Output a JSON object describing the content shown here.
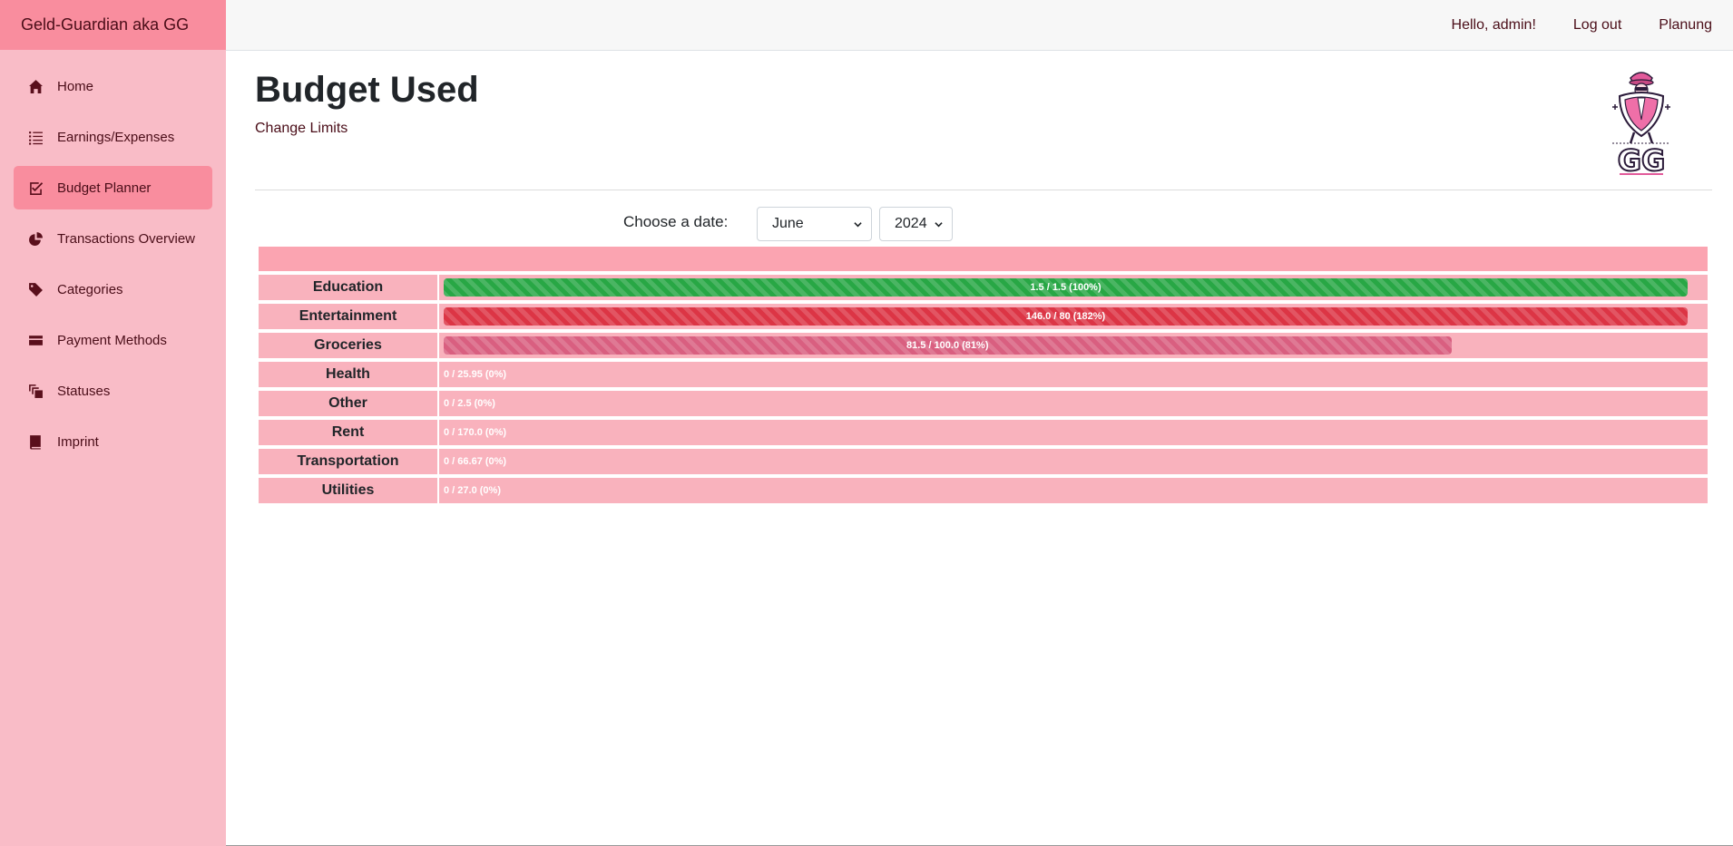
{
  "app": {
    "brand": "Geld-Guardian aka GG"
  },
  "sidebar": {
    "items": [
      {
        "label": "Home",
        "icon": "home-icon",
        "active": false
      },
      {
        "label": "Earnings/Expenses",
        "icon": "list-icon",
        "active": false
      },
      {
        "label": "Budget Planner",
        "icon": "check-square-icon",
        "active": true
      },
      {
        "label": "Transactions Overview",
        "icon": "pie-chart-icon",
        "active": false
      },
      {
        "label": "Categories",
        "icon": "tag-icon",
        "active": false
      },
      {
        "label": "Payment Methods",
        "icon": "credit-card-icon",
        "active": false
      },
      {
        "label": "Statuses",
        "icon": "stack-icon",
        "active": false
      },
      {
        "label": "Imprint",
        "icon": "book-icon",
        "active": false
      }
    ]
  },
  "topbar": {
    "greeting": "Hello, admin!",
    "logout": "Log out",
    "planung": "Planung"
  },
  "main": {
    "title": "Budget Used",
    "change_limits": "Change Limits",
    "date_label": "Choose a date:",
    "month": "June",
    "year": "2024"
  },
  "colors": {
    "brand": "#f98d9e",
    "sidebar": "#f9bcc7",
    "row": "#f9b2bd",
    "success": "#28a745",
    "danger": "#dc3545",
    "warning_pink": "#d95f80"
  },
  "budget_rows": [
    {
      "category": "Education",
      "label": "1.5 / 1.5 (100%)",
      "percent": 100,
      "color": "green"
    },
    {
      "category": "Entertainment",
      "label": "146.0 / 80 (182%)",
      "percent": 182,
      "color": "red"
    },
    {
      "category": "Groceries",
      "label": "81.5 / 100.0 (81%)",
      "percent": 81,
      "color": "pink"
    },
    {
      "category": "Health",
      "label": "0 / 25.95 (0%)",
      "percent": 0,
      "color": "none"
    },
    {
      "category": "Other",
      "label": "0 / 2.5 (0%)",
      "percent": 0,
      "color": "none"
    },
    {
      "category": "Rent",
      "label": "0 / 170.0 (0%)",
      "percent": 0,
      "color": "none"
    },
    {
      "category": "Transportation",
      "label": "0 / 66.67 (0%)",
      "percent": 0,
      "color": "none"
    },
    {
      "category": "Utilities",
      "label": "0 / 27.0 (0%)",
      "percent": 0,
      "color": "none"
    }
  ]
}
